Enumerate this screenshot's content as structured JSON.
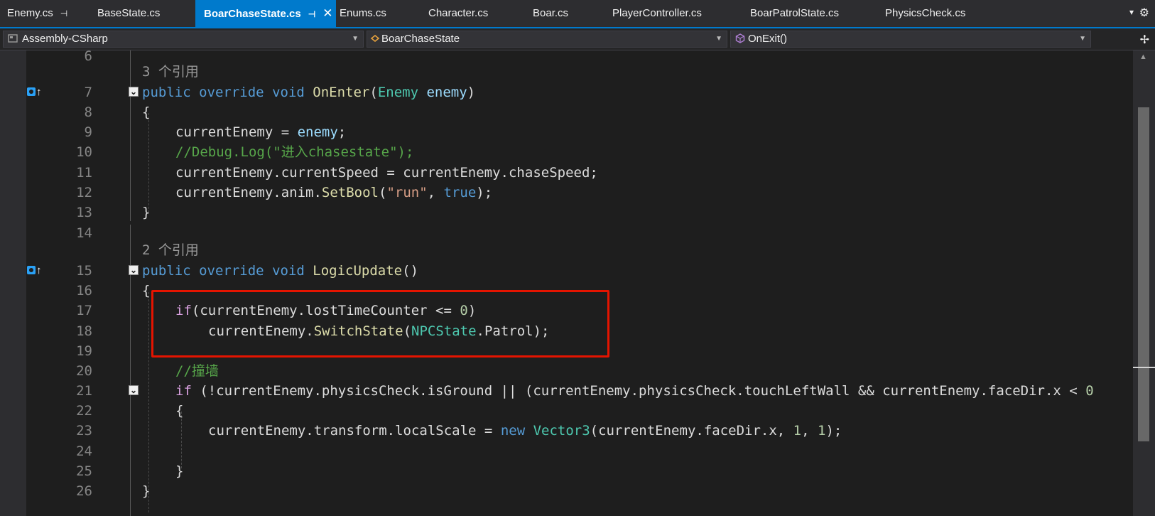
{
  "tabs": [
    {
      "label": "Enemy.cs",
      "pinned": true
    },
    {
      "label": "BaseState.cs"
    },
    {
      "label": "BoarChaseState.cs",
      "active": true,
      "pinned": true,
      "closable": true
    },
    {
      "label": "Enums.cs"
    },
    {
      "label": "Character.cs"
    },
    {
      "label": "Boar.cs"
    },
    {
      "label": "PlayerController.cs"
    },
    {
      "label": "BoarPatrolState.cs"
    },
    {
      "label": "PhysicsCheck.cs"
    }
  ],
  "tab_glyphs": {
    "pin": "⊣",
    "close": "✕",
    "overflow": "▾",
    "settings": "⚙",
    "split": "✢"
  },
  "nav": {
    "project": "Assembly-CSharp",
    "type": "BoarChaseState",
    "member": "OnExit()"
  },
  "codelens": {
    "ref3": "3 个引用",
    "ref2": "2 个引用"
  },
  "line_numbers": [
    "6",
    "7",
    "8",
    "9",
    "10",
    "11",
    "12",
    "13",
    "14",
    "15",
    "16",
    "17",
    "18",
    "19",
    "20",
    "21",
    "22",
    "23",
    "24",
    "25",
    "26"
  ],
  "code": {
    "l7": {
      "kw1": "public",
      "kw2": "override",
      "kw3": "void",
      "fn": "OnEnter",
      "p1": "(",
      "ty": "Enemy",
      "pr": "enemy",
      "p2": ")"
    },
    "l8": "{",
    "l9": {
      "a": "currentEnemy = ",
      "pr": "enemy",
      "b": ";"
    },
    "l10": "//Debug.Log(\"进入chasestate\");",
    "l11": "currentEnemy.currentSpeed = currentEnemy.chaseSpeed;",
    "l12": {
      "a": "currentEnemy.anim.",
      "fn": "SetBool",
      "b": "(",
      "st": "\"run\"",
      "c": ", ",
      "kw": "true",
      "d": ");"
    },
    "l13": "}",
    "l15": {
      "kw1": "public",
      "kw2": "override",
      "kw3": "void",
      "fn": "LogicUpdate",
      "p": "()"
    },
    "l16": "{",
    "l17": {
      "ctl": "if",
      "a": "(currentEnemy.lostTimeCounter <= ",
      "nm": "0",
      "b": ")"
    },
    "l18": {
      "a": "currentEnemy.",
      "fn": "SwitchState",
      "b": "(",
      "ty": "NPCState",
      "c": ".Patrol);"
    },
    "l20": "//撞墙",
    "l21": {
      "ctl": "if",
      "a": " (!currentEnemy.physicsCheck.isGround || (currentEnemy.physicsCheck.touchLeftWall && currentEnemy.faceDir.x < ",
      "nm": "0"
    },
    "l22": "{",
    "l23": {
      "a": "currentEnemy.transform.localScale = ",
      "kw": "new",
      "b": " ",
      "ty": "Vector3",
      "c": "(currentEnemy.faceDir.x, ",
      "n1": "1",
      "d": ", ",
      "n2": "1",
      "e": ");"
    },
    "l25": "}",
    "l26": "}"
  }
}
